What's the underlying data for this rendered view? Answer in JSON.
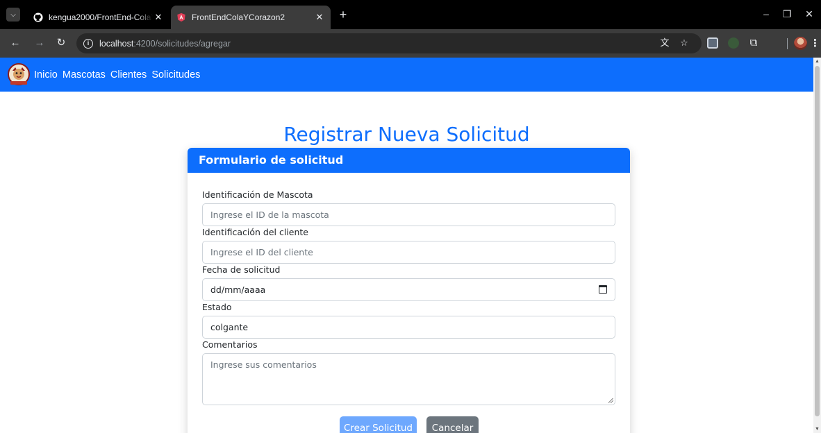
{
  "browser": {
    "tabs": [
      {
        "title": "kengua2000/FrontEnd-ColaYCo",
        "active": false,
        "icon": "github-icon"
      },
      {
        "title": "FrontEndColaYCorazon2",
        "active": true,
        "icon": "angular-icon"
      }
    ],
    "url": {
      "host": "localhost",
      "path": ":4200/solicitudes/agregar"
    }
  },
  "nav": {
    "links": [
      "Inicio",
      "Mascotas",
      "Clientes",
      "Solicitudes"
    ]
  },
  "page": {
    "title": "Registrar Nueva Solicitud"
  },
  "card": {
    "header": "Formulario de solicitud"
  },
  "form": {
    "pet_id": {
      "label": "Identificación de Mascota",
      "placeholder": "Ingrese el ID de la mascota",
      "value": ""
    },
    "client_id": {
      "label": "Identificación del cliente",
      "placeholder": "Ingrese el ID del cliente",
      "value": ""
    },
    "date": {
      "label": "Fecha de solicitud",
      "value": "dd/mm/aaaa"
    },
    "status": {
      "label": "Estado",
      "value": "colgante"
    },
    "comments": {
      "label": "Comentarios",
      "placeholder": "Ingrese sus comentarios",
      "value": ""
    },
    "submit_label": "Crear Solicitud",
    "cancel_label": "Cancelar"
  },
  "colors": {
    "primary": "#0d6efd",
    "primary_disabled": "#6ea8fe",
    "secondary": "#6c757d"
  }
}
